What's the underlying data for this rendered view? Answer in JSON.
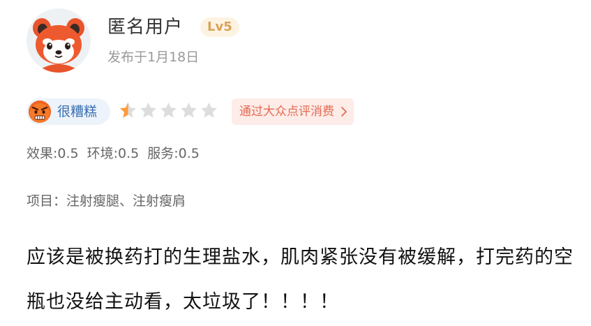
{
  "user": {
    "name": "匿名用户",
    "level": "Lv5",
    "date": "发布于1月18日",
    "avatar_icon": "red-panda-icon"
  },
  "rating": {
    "mood_label": "很糟糕",
    "mood_icon": "angry-face-icon",
    "stars_total": 5,
    "stars_value": 0.5,
    "star_color": "#ff9a3c",
    "source_label": "通过大众点评消费",
    "source_icon": "chevron-right-icon"
  },
  "scores": {
    "effect": "效果:0.5",
    "environment": "环境:0.5",
    "service": "服务:0.5"
  },
  "project": "项目：注射瘦腿、注射瘦肩",
  "review_text": "应该是被换药打的生理盐水，肌肉紧张没有被缓解，打完药的空瓶也没给主动看，太垃圾了！！！！"
}
